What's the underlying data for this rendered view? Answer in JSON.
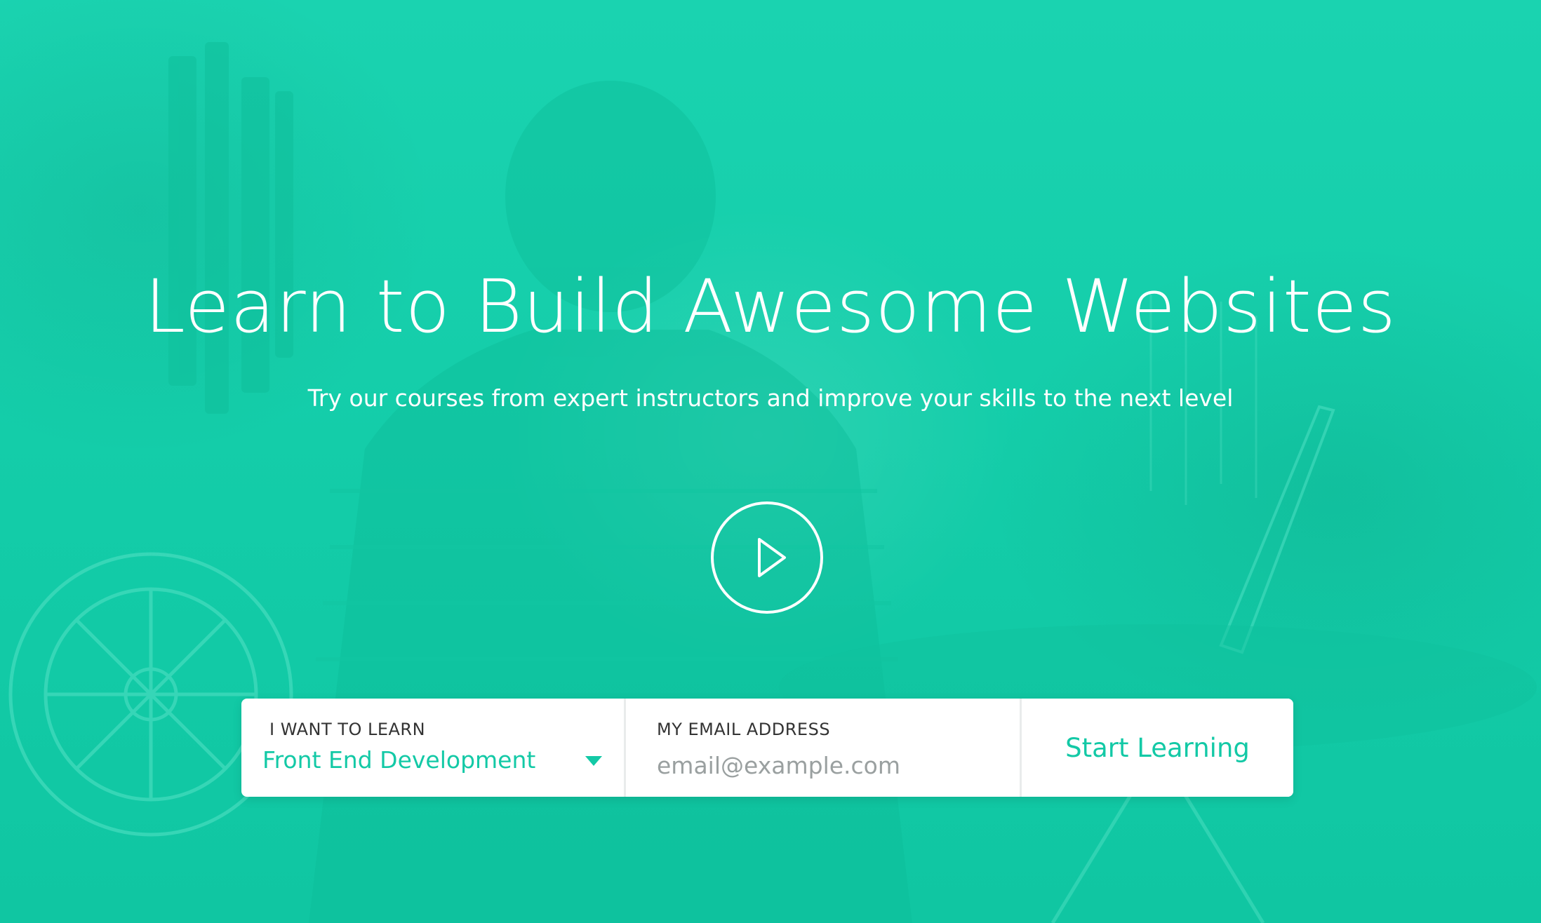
{
  "hero": {
    "title": "Learn to Build Awesome Websites",
    "subtitle": "Try our courses from expert instructors and improve your skills to the next level",
    "overlay_color": "#17cfab"
  },
  "video": {
    "icon": "play-icon"
  },
  "signup": {
    "learn_label": "I WANT TO LEARN",
    "learn_value": "Front End Development",
    "email_label": "MY EMAIL ADDRESS",
    "email_placeholder": "email@example.com",
    "email_value": "",
    "submit_label": "Start Learning",
    "accent_color": "#13c9a6"
  }
}
